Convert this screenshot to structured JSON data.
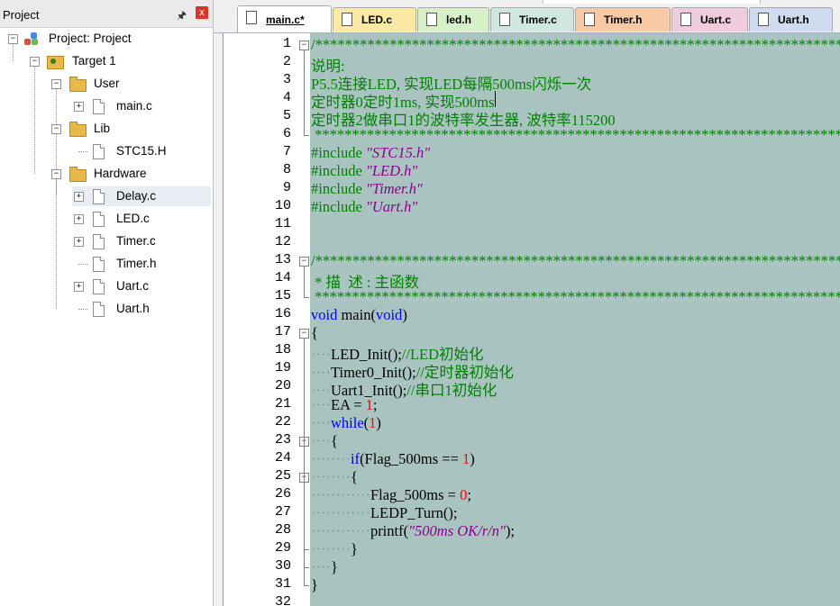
{
  "project_panel": {
    "title": "Project",
    "pin_glyph": "ᴘ",
    "close_glyph": "x",
    "tree": [
      {
        "label": "Project: Project",
        "type": "project",
        "expander": "−"
      },
      {
        "label": "Target 1",
        "type": "target",
        "expander": "−"
      },
      {
        "label": "User",
        "type": "folder",
        "expander": "−"
      },
      {
        "label": "main.c",
        "type": "file",
        "expander": "+"
      },
      {
        "label": "Lib",
        "type": "folder",
        "expander": "−"
      },
      {
        "label": "STC15.H",
        "type": "file",
        "expander": ""
      },
      {
        "label": "Hardware",
        "type": "folder",
        "expander": "−"
      },
      {
        "label": "Delay.c",
        "type": "file",
        "expander": "+"
      },
      {
        "label": "LED.c",
        "type": "file",
        "expander": "+"
      },
      {
        "label": "Timer.c",
        "type": "file",
        "expander": "+"
      },
      {
        "label": "Timer.h",
        "type": "file",
        "expander": ""
      },
      {
        "label": "Uart.c",
        "type": "file",
        "expander": "+"
      },
      {
        "label": "Uart.h",
        "type": "file",
        "expander": ""
      }
    ]
  },
  "tabs": [
    {
      "label": "main.c*",
      "color": "#ffffff",
      "active": true
    },
    {
      "label": "LED.c",
      "color": "#fce9a3"
    },
    {
      "label": "led.h",
      "color": "#d8f0c8"
    },
    {
      "label": "Timer.c",
      "color": "#cfe7df"
    },
    {
      "label": "Timer.h",
      "color": "#f7c9a5"
    },
    {
      "label": "Uart.c",
      "color": "#eeccdc"
    },
    {
      "label": "Uart.h",
      "color": "#cfdbee"
    }
  ],
  "editor": {
    "background": "#a9c4c0",
    "lines": [
      {
        "n": "1",
        "fold": "−",
        "tokens": [
          [
            "c",
            "/*************************************************************************"
          ]
        ]
      },
      {
        "n": "2",
        "tokens": [
          [
            "c",
            "说明:"
          ]
        ]
      },
      {
        "n": "3",
        "tokens": [
          [
            "c",
            "P5.5连接LED, 实现LED每隔500ms闪烁一次"
          ]
        ]
      },
      {
        "n": "4",
        "tokens": [
          [
            "c",
            "定时器0定时1ms, 实现500ms"
          ]
        ]
      },
      {
        "n": "5",
        "tokens": [
          [
            "c",
            "定时器2做串口1的波特率发生器, 波特率115200"
          ]
        ]
      },
      {
        "n": "6",
        "tokens": [
          [
            "c",
            " ************************************************************************"
          ]
        ]
      },
      {
        "n": "7",
        "tokens": [
          [
            "c",
            "#include "
          ],
          [
            "s",
            "\"STC15.h\""
          ]
        ]
      },
      {
        "n": "8",
        "tokens": [
          [
            "c",
            "#include "
          ],
          [
            "s",
            "\"LED.h\""
          ]
        ]
      },
      {
        "n": "9",
        "tokens": [
          [
            "c",
            "#include "
          ],
          [
            "s",
            "\"Timer.h\""
          ]
        ]
      },
      {
        "n": "10",
        "tokens": [
          [
            "c",
            "#include "
          ],
          [
            "s",
            "\"Uart.h\""
          ]
        ]
      },
      {
        "n": "11",
        "tokens": []
      },
      {
        "n": "12",
        "tokens": []
      },
      {
        "n": "13",
        "fold": "−",
        "tokens": [
          [
            "c",
            "/*************************************************************************"
          ]
        ]
      },
      {
        "n": "14",
        "tokens": [
          [
            "c",
            " * 描  述 : 主函数"
          ]
        ]
      },
      {
        "n": "15",
        "tokens": [
          [
            "c",
            " ************************************************************************"
          ]
        ]
      },
      {
        "n": "16",
        "tokens": [
          [
            "k",
            "void"
          ],
          [
            "p",
            " main("
          ],
          [
            "k",
            "void"
          ],
          [
            "p",
            ")"
          ]
        ]
      },
      {
        "n": "17",
        "fold": "−",
        "tokens": [
          [
            "p",
            "{"
          ]
        ]
      },
      {
        "n": "18",
        "tokens": [
          [
            "d",
            "····"
          ],
          [
            "p",
            "LED_Init();"
          ],
          [
            "c",
            "//LED初始化"
          ]
        ]
      },
      {
        "n": "19",
        "tokens": [
          [
            "d",
            "····"
          ],
          [
            "p",
            "Timer0_Init();"
          ],
          [
            "c",
            "//定时器初始化"
          ]
        ]
      },
      {
        "n": "20",
        "tokens": [
          [
            "d",
            "····"
          ],
          [
            "p",
            "Uart1_Init();"
          ],
          [
            "c",
            "//串口1初始化"
          ]
        ]
      },
      {
        "n": "21",
        "tokens": [
          [
            "d",
            "····"
          ],
          [
            "p",
            "EA = "
          ],
          [
            "n",
            "1"
          ],
          [
            "p",
            ";"
          ]
        ]
      },
      {
        "n": "22",
        "tokens": [
          [
            "d",
            "····"
          ],
          [
            "k",
            "while"
          ],
          [
            "p",
            "("
          ],
          [
            "n",
            "1"
          ],
          [
            "p",
            ")"
          ]
        ]
      },
      {
        "n": "23",
        "fold": "−",
        "tokens": [
          [
            "d",
            "····"
          ],
          [
            "p",
            "{"
          ]
        ]
      },
      {
        "n": "24",
        "tokens": [
          [
            "d",
            "········"
          ],
          [
            "k",
            "if"
          ],
          [
            "p",
            "(Flag_500ms == "
          ],
          [
            "n",
            "1"
          ],
          [
            "p",
            ")"
          ]
        ]
      },
      {
        "n": "25",
        "fold": "−",
        "tokens": [
          [
            "d",
            "········"
          ],
          [
            "p",
            "{"
          ]
        ]
      },
      {
        "n": "26",
        "tokens": [
          [
            "d",
            "············"
          ],
          [
            "p",
            "Flag_500ms = "
          ],
          [
            "n",
            "0"
          ],
          [
            "p",
            ";"
          ]
        ]
      },
      {
        "n": "27",
        "tokens": [
          [
            "d",
            "············"
          ],
          [
            "p",
            "LEDP_Turn();"
          ]
        ]
      },
      {
        "n": "28",
        "tokens": [
          [
            "d",
            "············"
          ],
          [
            "p",
            "printf("
          ],
          [
            "s",
            "\"500ms OK/r/n\""
          ],
          [
            "p",
            ");"
          ]
        ]
      },
      {
        "n": "29",
        "tokens": [
          [
            "d",
            "········"
          ],
          [
            "p",
            "}"
          ]
        ]
      },
      {
        "n": "30",
        "tokens": [
          [
            "d",
            "····"
          ],
          [
            "p",
            "}"
          ]
        ]
      },
      {
        "n": "31",
        "tokens": [
          [
            "p",
            "}"
          ]
        ]
      },
      {
        "n": "32",
        "tokens": []
      }
    ]
  }
}
